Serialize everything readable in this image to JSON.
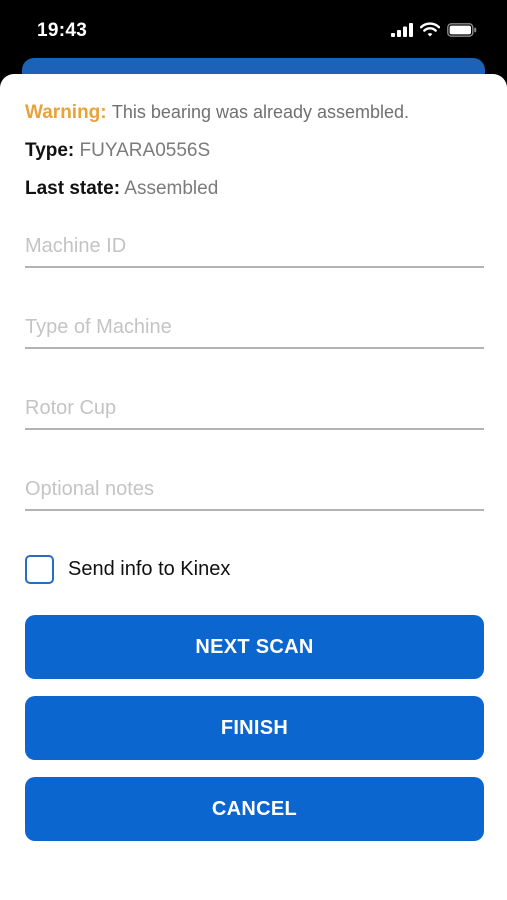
{
  "status_bar": {
    "time": "19:43",
    "icons": [
      "cellular-signal-icon",
      "wifi-icon",
      "battery-icon"
    ]
  },
  "info": {
    "warning_label": "Warning:",
    "warning_text": "This bearing was already assembled.",
    "type_label": "Type:",
    "type_value": "FUYARA0556S",
    "last_state_label": "Last state:",
    "last_state_value": "Assembled"
  },
  "form": {
    "machine_id_placeholder": "Machine ID",
    "machine_type_placeholder": "Type of Machine",
    "rotor_cup_placeholder": "Rotor Cup",
    "notes_placeholder": "Optional notes",
    "send_info_label": "Send info to Kinex",
    "send_info_checked": false
  },
  "buttons": {
    "next_scan": "NEXT SCAN",
    "finish": "FINISH",
    "cancel": "CANCEL"
  },
  "colors": {
    "accent": "#0b66cf",
    "warning": "#e8a23c",
    "status_bar_bg": "#000000"
  }
}
